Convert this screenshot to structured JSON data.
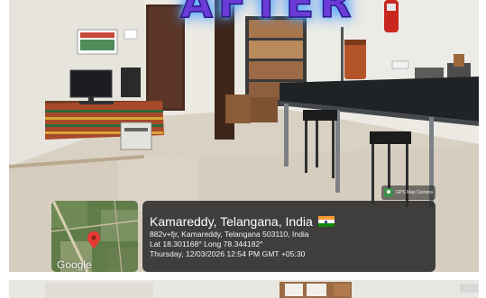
{
  "overlay_title": "AFTER",
  "gps_badge": {
    "text": "GPS Map Camera"
  },
  "map": {
    "provider": "Google"
  },
  "location": {
    "place": "Kamareddy, Telangana, India",
    "address": "882v+fjr, Kamareddy, Telangana 503110, India",
    "coords": "Lat 18.301168° Long 78.344182°",
    "datetime": "Thursday, 12/03/2026 12:54 PM GMT +05:30"
  },
  "colors": {
    "title_fill": "#6b3bd8",
    "title_glow": "#57a8ff",
    "panel_bg": "#2a2a2a",
    "pin": "#e53935"
  }
}
